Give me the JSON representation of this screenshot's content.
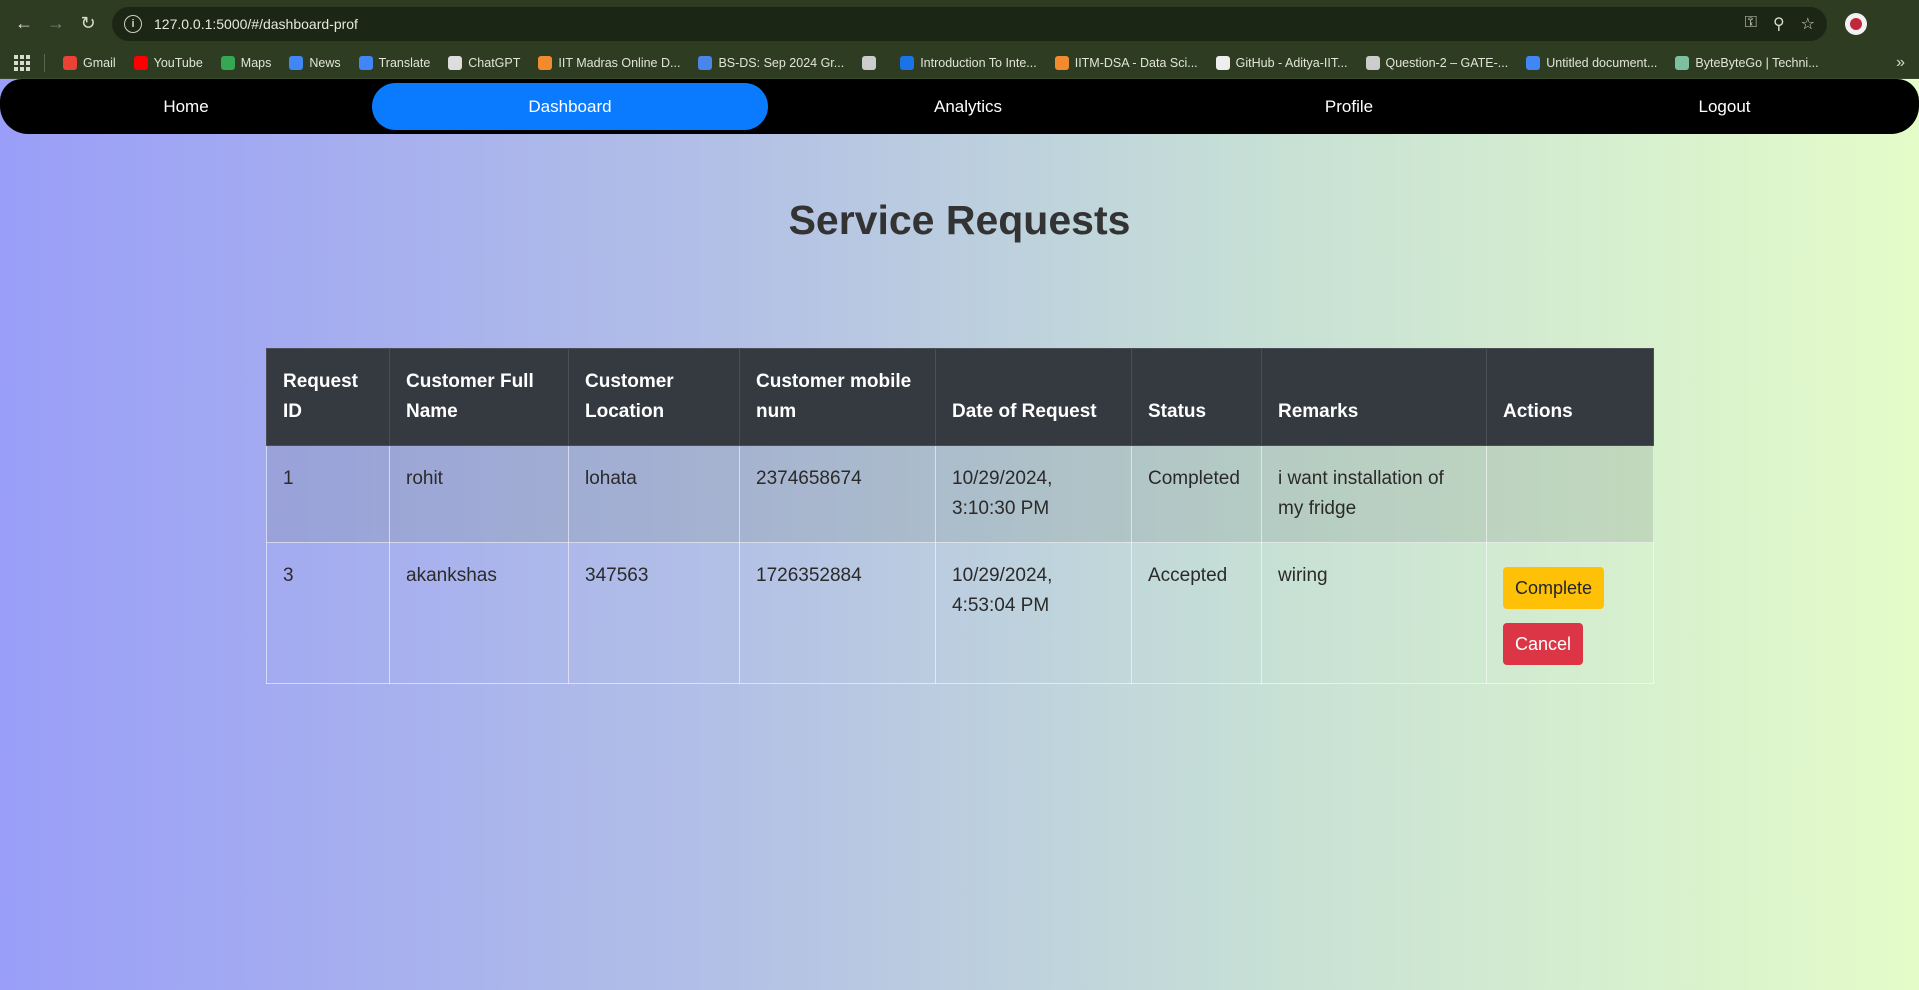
{
  "browser": {
    "url": "127.0.0.1:5000/#/dashboard-prof",
    "bookmarks": [
      {
        "label": "Gmail",
        "color": "#ea4335"
      },
      {
        "label": "YouTube",
        "color": "#ff0000"
      },
      {
        "label": "Maps",
        "color": "#34a853"
      },
      {
        "label": "News",
        "color": "#4285f4"
      },
      {
        "label": "Translate",
        "color": "#4285f4"
      },
      {
        "label": "ChatGPT",
        "color": "#dddddd"
      },
      {
        "label": "IIT Madras Online D...",
        "color": "#f28b30"
      },
      {
        "label": "BS-DS: Sep 2024 Gr...",
        "color": "#4a86e8"
      },
      {
        "label": "",
        "color": "#cccccc"
      },
      {
        "label": "Introduction To Inte...",
        "color": "#1a73e8"
      },
      {
        "label": "IITM-DSA - Data Sci...",
        "color": "#f28b30"
      },
      {
        "label": "GitHub - Aditya-IIT...",
        "color": "#eeeeee"
      },
      {
        "label": "Question-2 – GATE-...",
        "color": "#cccccc"
      },
      {
        "label": "Untitled document...",
        "color": "#4285f4"
      },
      {
        "label": "ByteByteGo | Techni...",
        "color": "#7cc0a0"
      }
    ]
  },
  "nav": {
    "items": [
      "Home",
      "Dashboard",
      "Analytics",
      "Profile",
      "Logout"
    ],
    "active": "Dashboard",
    "accent": "#0a7bff"
  },
  "main": {
    "title": "Service Requests",
    "columns": [
      "Request ID",
      "Customer Full Name",
      "Customer Location",
      "Customer mobile num",
      "Date of Request",
      "Status",
      "Remarks",
      "Actions"
    ],
    "rows": [
      {
        "id": "1",
        "name": "rohit",
        "location": "lohata",
        "mobile": "2374658674",
        "date": "10/29/2024, 3:10:30 PM",
        "status": "Completed",
        "remarks": "i want installation of my fridge",
        "actions": []
      },
      {
        "id": "3",
        "name": "akankshas",
        "location": "347563",
        "mobile": "1726352884",
        "date": "10/29/2024, 4:53:04 PM",
        "status": "Accepted",
        "remarks": "wiring",
        "actions": [
          "Complete",
          "Cancel"
        ]
      }
    ]
  }
}
